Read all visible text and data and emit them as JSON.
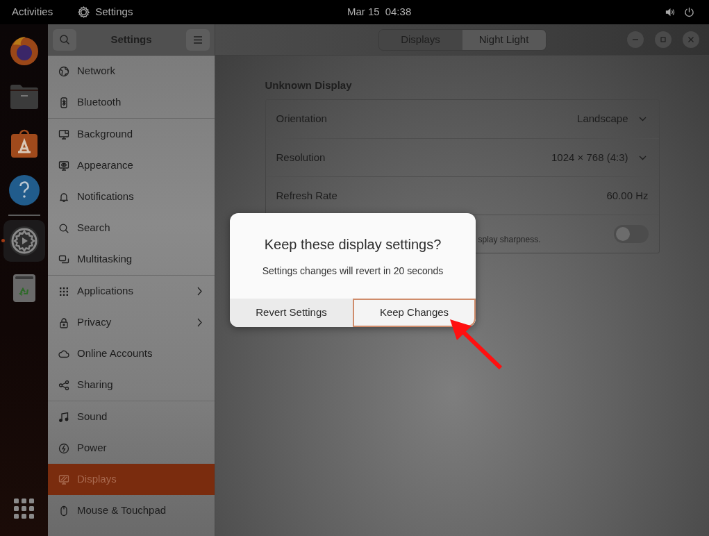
{
  "top_bar": {
    "activities": "Activities",
    "app_menu": "Settings",
    "date": "Mar 15",
    "time": "04:38"
  },
  "dock": {
    "sections": [
      {
        "items": [
          {
            "kind": "browser",
            "running": false
          },
          {
            "kind": "files",
            "running": false
          },
          {
            "kind": "store",
            "running": false
          },
          {
            "kind": "help",
            "running": false
          }
        ]
      },
      {
        "items": [
          {
            "kind": "settings",
            "running": true
          },
          {
            "kind": "trash",
            "running": false
          }
        ]
      }
    ]
  },
  "sidebar": {
    "title": "Settings",
    "sections": [
      {
        "items": [
          {
            "kind": "network",
            "label": "Network",
            "submenu": false,
            "selected": false
          },
          {
            "kind": "bluetooth",
            "label": "Bluetooth",
            "submenu": false,
            "selected": false
          }
        ]
      },
      {
        "items": [
          {
            "kind": "background",
            "label": "Background",
            "submenu": false,
            "selected": false
          },
          {
            "kind": "appearance",
            "label": "Appearance",
            "submenu": false,
            "selected": false
          },
          {
            "kind": "notifications",
            "label": "Notifications",
            "submenu": false,
            "selected": false
          },
          {
            "kind": "search",
            "label": "Search",
            "submenu": false,
            "selected": false
          },
          {
            "kind": "multitasking",
            "label": "Multitasking",
            "submenu": false,
            "selected": false
          }
        ]
      },
      {
        "items": [
          {
            "kind": "applications",
            "label": "Applications",
            "submenu": true,
            "selected": false
          },
          {
            "kind": "privacy",
            "label": "Privacy",
            "submenu": true,
            "selected": false
          },
          {
            "kind": "accounts",
            "label": "Online Accounts",
            "submenu": false,
            "selected": false
          },
          {
            "kind": "sharing",
            "label": "Sharing",
            "submenu": false,
            "selected": false
          }
        ]
      },
      {
        "items": [
          {
            "kind": "sound",
            "label": "Sound",
            "submenu": false,
            "selected": false
          },
          {
            "kind": "power",
            "label": "Power",
            "submenu": false,
            "selected": false
          },
          {
            "kind": "displays",
            "label": "Displays",
            "submenu": false,
            "selected": true
          },
          {
            "kind": "mouse",
            "label": "Mouse & Touchpad",
            "submenu": false,
            "selected": false
          }
        ]
      }
    ]
  },
  "tabs": [
    {
      "label": "Displays",
      "selected": true
    },
    {
      "label": "Night Light",
      "selected": false
    }
  ],
  "display": {
    "name": "Unknown Display",
    "rows": [
      {
        "kind": "dropdown",
        "label": "Orientation",
        "value": "Landscape"
      },
      {
        "kind": "dropdown",
        "label": "Resolution",
        "value": "1024 × 768 (4:3)"
      },
      {
        "kind": "text",
        "label": "Refresh Rate",
        "value": "60.00 Hz"
      },
      {
        "kind": "switch",
        "description": "splay sharpness.",
        "on": false
      }
    ]
  },
  "dialog": {
    "title": "Keep these display settings?",
    "message": "Settings changes will revert in 20 seconds",
    "buttons": [
      {
        "label": "Revert Settings",
        "focused": false
      },
      {
        "label": "Keep Changes",
        "focused": true
      }
    ]
  }
}
